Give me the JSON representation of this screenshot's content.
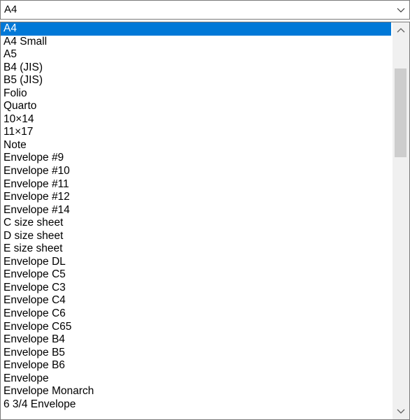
{
  "combo": {
    "value": "A4",
    "arrow_icon": "chevron-down-icon"
  },
  "list": {
    "selected_index": 0,
    "items": [
      "A4",
      "A4 Small",
      "A5",
      "B4 (JIS)",
      "B5 (JIS)",
      "Folio",
      "Quarto",
      "10×14",
      "11×17",
      "Note",
      "Envelope #9",
      "Envelope #10",
      "Envelope #11",
      "Envelope #12",
      "Envelope #14",
      "C size sheet",
      "D size sheet",
      "E size sheet",
      "Envelope DL",
      "Envelope C5",
      "Envelope C3",
      "Envelope C4",
      "Envelope C6",
      "Envelope C65",
      "Envelope B4",
      "Envelope B5",
      "Envelope B6",
      "Envelope",
      "Envelope Monarch",
      "6 3/4 Envelope"
    ]
  },
  "scrollbar": {
    "up_icon": "chevron-up-icon",
    "down_icon": "chevron-down-icon"
  },
  "colors": {
    "selection": "#0078d7",
    "scroll_track": "#f0f0f0",
    "scroll_thumb": "#cdcdcd"
  }
}
